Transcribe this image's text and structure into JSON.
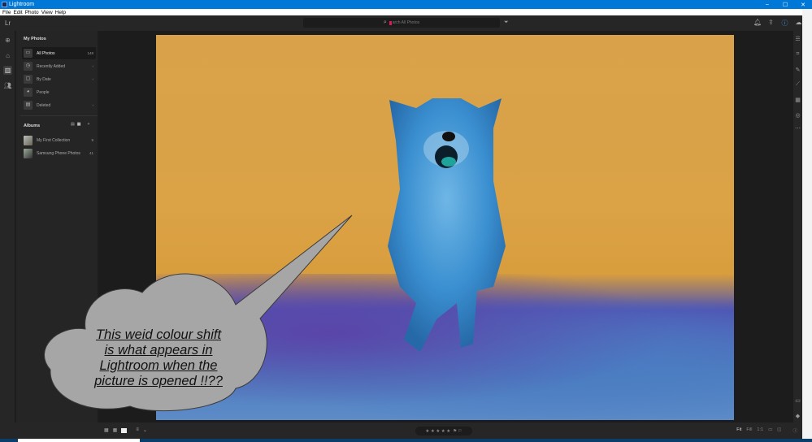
{
  "window": {
    "title": "Lightroom",
    "controls": {
      "minimize": "–",
      "maximize": "☐",
      "close": "✕"
    }
  },
  "menu": [
    "File",
    "Edit",
    "Photo",
    "View",
    "Help"
  ],
  "header": {
    "logo": "Lr",
    "search_placeholder": "Search All Photos",
    "search_typed_visible": "arch All Photos",
    "icons": [
      "bell-icon",
      "share-icon",
      "help-icon",
      "cloud-sync-icon"
    ]
  },
  "left_rail": {
    "icons": [
      "add-photos-icon",
      "home-icon",
      "library-icon",
      "shared-icon"
    ],
    "active": "library-icon"
  },
  "sidebar": {
    "my_photos_title": "My Photos",
    "items": [
      {
        "label": "All Photos",
        "count": "148",
        "icon": "photo-icon",
        "active": true
      },
      {
        "label": "Recently Added",
        "count": "‹",
        "icon": "clock-icon"
      },
      {
        "label": "By Date",
        "count": "‹",
        "icon": "calendar-icon"
      },
      {
        "label": "People",
        "count": "",
        "icon": "person-icon"
      },
      {
        "label": "Deleted",
        "count": "›",
        "icon": "trash-icon"
      }
    ],
    "albums_title": "Albums",
    "albums_add": "+",
    "albums": [
      {
        "label": "My First Collection",
        "count": "9"
      },
      {
        "label": "Samsung Phone Photos",
        "count": "41"
      }
    ]
  },
  "right_rail": {
    "top_icons": [
      "edit-sliders-icon",
      "crop-icon",
      "healing-icon",
      "brush-icon",
      "linear-gradient-icon",
      "radial-gradient-icon",
      "more-icon"
    ],
    "bottom_icons": [
      "comment-icon",
      "tag-icon",
      "info-icon"
    ]
  },
  "bottom_bar": {
    "view_modes": [
      "square-grid-icon",
      "photo-grid-icon",
      "detail-view-icon"
    ],
    "sort_label": "≡",
    "rating_stars": 0,
    "rating_max": 5,
    "flags": "⚑ ⚐",
    "zoom_options": [
      "Fit",
      "Fill",
      "1:1"
    ],
    "active_zoom": "Fit"
  },
  "annotation": {
    "text": "This weid colour shift is what appears in Lightroom when the picture is opened  !!??",
    "lines": [
      "This weid colour shift",
      "is what appears in",
      "Lightroom when the",
      "picture is opened  !!??"
    ],
    "fill": "#a6a6a6"
  },
  "colors": {
    "titlebar": "#0078d7",
    "background": "#1e1e1e",
    "sky": "#d9a24a",
    "dog": "#3a8fd0",
    "grass": "#5056b5"
  }
}
